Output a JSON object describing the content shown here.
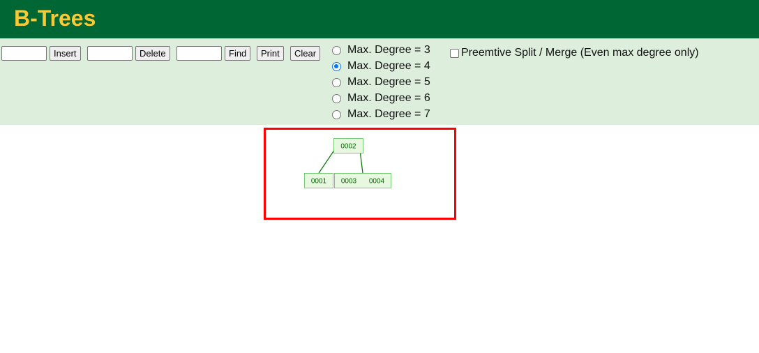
{
  "header": {
    "title": "B-Trees",
    "bg": "#006633",
    "title_color": "#f9c935"
  },
  "controls": {
    "insert_value": "",
    "insert_label": "Insert",
    "delete_value": "",
    "delete_label": "Delete",
    "find_value": "",
    "find_label": "Find",
    "print_label": "Print",
    "clear_label": "Clear",
    "degrees": [
      {
        "label": "Max. Degree = 3",
        "checked": false
      },
      {
        "label": "Max. Degree = 4",
        "checked": true
      },
      {
        "label": "Max. Degree = 5",
        "checked": false
      },
      {
        "label": "Max. Degree = 6",
        "checked": false
      },
      {
        "label": "Max. Degree = 7",
        "checked": false
      }
    ],
    "preemptive_label": "Preemtive Split / Merge (Even max degree only)",
    "preemptive_checked": false
  },
  "tree": {
    "root": {
      "keys": [
        "0002"
      ]
    },
    "children": [
      {
        "keys": [
          "0001"
        ]
      },
      {
        "keys": [
          "0003",
          "0004"
        ]
      }
    ],
    "node_fill": "#e8f8e0",
    "node_stroke": "#66bb66",
    "text_color": "#006600"
  },
  "highlight_color": "#ff0000"
}
